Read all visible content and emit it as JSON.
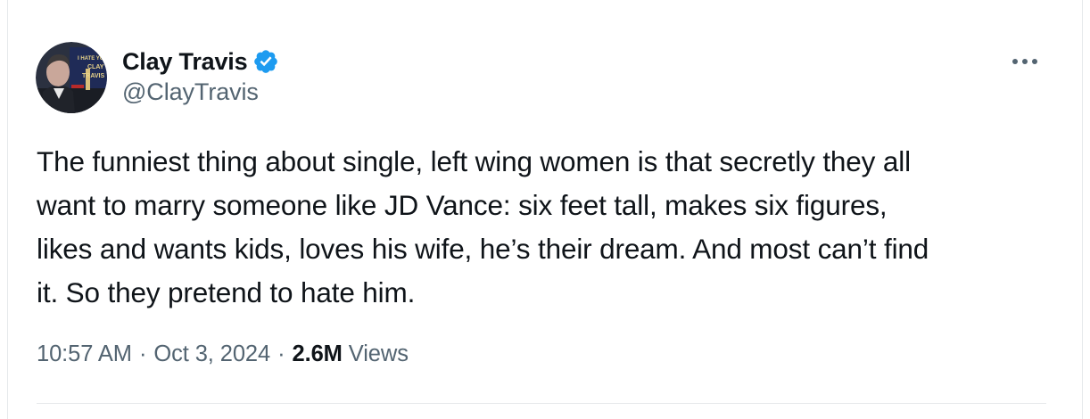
{
  "author": {
    "display_name": "Clay Travis",
    "handle": "@ClayTravis",
    "verified": true,
    "verified_color": "#1d9bf0",
    "avatar_icon": "profile-photo",
    "avatar_sign_text": "I HATE YOU CLAY TRAVIS"
  },
  "more_icon": "ellipsis-icon",
  "tweet": {
    "lines": [
      "The funniest thing about single, left wing women is that secretly they all",
      "want to marry someone like JD Vance: six feet tall, makes six figures,",
      "likes and wants kids, loves his wife, he’s their dream. And most can’t find",
      "it. So they pretend to hate him."
    ]
  },
  "meta": {
    "time": "10:57 AM",
    "separator": "·",
    "date": "Oct 3, 2024",
    "views_count": "2.6M",
    "views_label": "Views"
  },
  "colors": {
    "text_primary": "#0f1419",
    "text_secondary": "#536471",
    "divider": "#e6e9eb"
  }
}
